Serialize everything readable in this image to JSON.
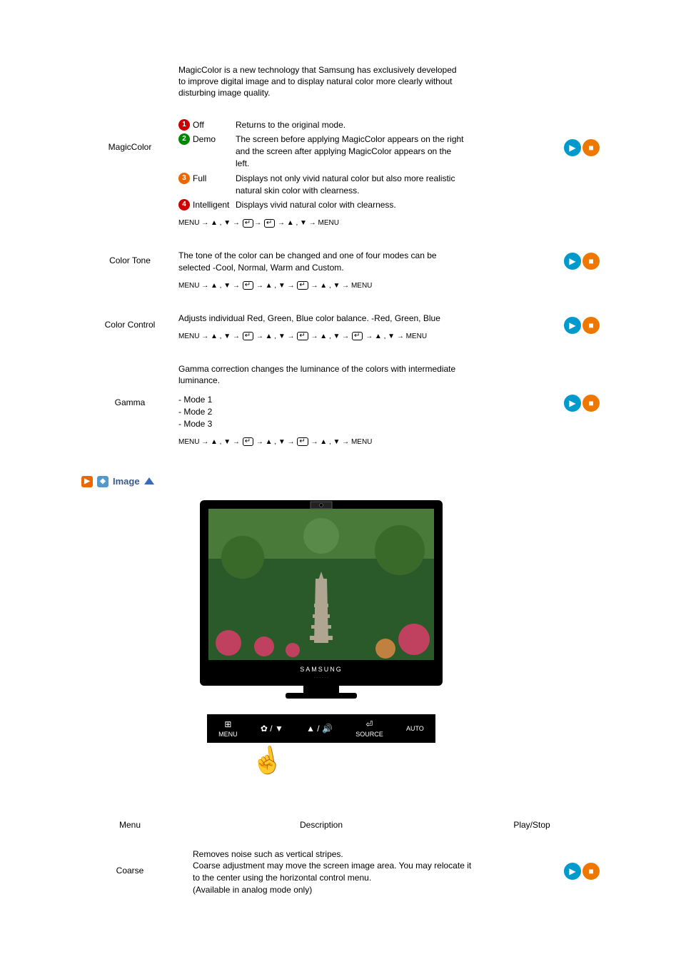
{
  "intro": "MagicColor is a new technology that Samsung has exclusively developed to improve digital image and to display natural color more clearly without disturbing image quality.",
  "magiccolor": {
    "label": "MagicColor",
    "modes": [
      {
        "n": "1",
        "name": "Off",
        "desc": "Returns to the original mode."
      },
      {
        "n": "2",
        "name": "Demo",
        "desc": "The screen before applying MagicColor appears on the right and the screen after applying MagicColor appears on the left."
      },
      {
        "n": "3",
        "name": "Full",
        "desc": "Displays not only vivid natural color but also more realistic natural skin color with clearness."
      },
      {
        "n": "4",
        "name": "Intelligent",
        "desc": "Displays vivid natural color with clearness."
      }
    ],
    "path_segments": [
      "MENU →",
      ",",
      "→",
      "→",
      "→",
      ",",
      "→ MENU"
    ],
    "arrows": [
      "▲",
      "▼",
      "▲",
      "▼"
    ]
  },
  "colortone": {
    "label": "Color Tone",
    "desc": "The tone of the color can be changed and one of four modes can be selected -Cool, Normal, Warm and Custom.",
    "path_prefix": "MENU →",
    "path_suffix": "→ MENU"
  },
  "colorcontrol": {
    "label": "Color Control",
    "desc": "Adjusts individual Red, Green, Blue color balance. -Red, Green, Blue",
    "path_prefix": "MENU →",
    "path_suffix": "→ MENU"
  },
  "gamma": {
    "label": "Gamma",
    "desc": "Gamma correction changes the luminance of the colors with intermediate luminance.",
    "modes": [
      "- Mode 1",
      "- Mode 2",
      "- Mode 3"
    ],
    "path_prefix": "MENU →",
    "path_suffix": "→ MENU"
  },
  "image_section": {
    "title": "Image",
    "osd_brand": "SAMSUNG",
    "buttons": [
      "MENU",
      "",
      "",
      "SOURCE",
      "AUTO"
    ],
    "button_icons": [
      "⊞",
      "⚙ / ▼",
      "▲ / ⏐⃦⊳",
      "⏎",
      ""
    ]
  },
  "headers": {
    "menu": "Menu",
    "description": "Description",
    "playstop": "Play/Stop"
  },
  "coarse": {
    "label": "Coarse",
    "lines": [
      "Removes noise such as vertical stripes.",
      "Coarse adjustment may move the screen image area. You may relocate it to the center using the horizontal control menu.",
      "(Available in analog mode only)"
    ]
  }
}
